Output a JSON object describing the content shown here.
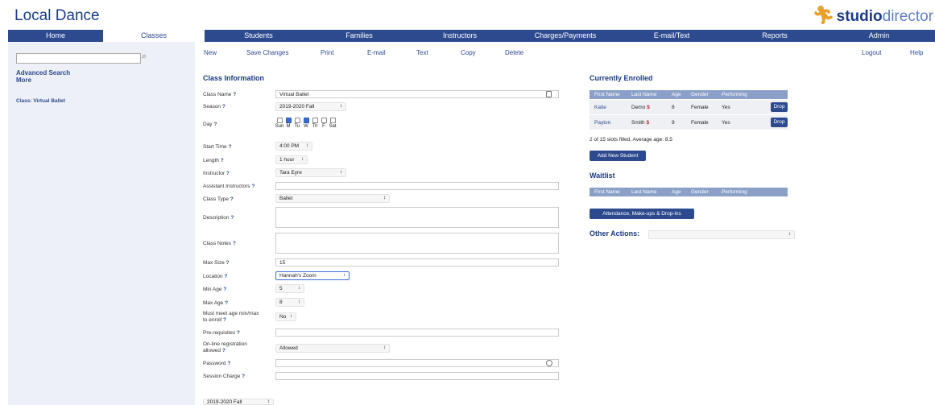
{
  "app": {
    "title": "Local Dance",
    "logo_bold": "studio",
    "logo_light": "director"
  },
  "nav": {
    "tabs": [
      "Home",
      "Classes",
      "Students",
      "Families",
      "Instructors",
      "Charges/Payments",
      "E-mail/Text",
      "Reports",
      "Admin"
    ],
    "active": "Classes"
  },
  "sidebar": {
    "search_value": "",
    "advanced_search": "Advanced Search",
    "more": "More",
    "class_link": "Class: Virtual Ballet"
  },
  "toolbar": {
    "new": "New",
    "save": "Save Changes",
    "print": "Print",
    "email": "E-mail",
    "text": "Text",
    "copy": "Copy",
    "delete": "Delete",
    "logout": "Logout",
    "help": "Help"
  },
  "form": {
    "title": "Class Information",
    "help_mark": "?",
    "class_name": {
      "label": "Class Name",
      "value": "Virtual Ballet"
    },
    "season": {
      "label": "Season",
      "value": "2019-2020 Fall"
    },
    "day": {
      "label": "Day",
      "days": [
        "Sun",
        "M",
        "Tu",
        "W",
        "Th",
        "F",
        "Sat"
      ],
      "checked": [
        false,
        true,
        false,
        true,
        false,
        false,
        false
      ]
    },
    "start_time": {
      "label": "Start Time",
      "value": "4:00 PM"
    },
    "length": {
      "label": "Length",
      "value": "1 hour"
    },
    "instructor": {
      "label": "Instructor",
      "value": "Tara Eyre"
    },
    "assistant": {
      "label": "Assistant Instructors",
      "value": ""
    },
    "class_type": {
      "label": "Class Type",
      "value": "Ballet"
    },
    "description": {
      "label": "Description",
      "value": ""
    },
    "class_notes": {
      "label": "Class Notes",
      "value": ""
    },
    "max_size": {
      "label": "Max Size",
      "value": "15"
    },
    "location": {
      "label": "Location",
      "value": "Hannah's Zoom"
    },
    "min_age": {
      "label": "Min Age",
      "value": "5"
    },
    "max_age": {
      "label": "Max Age",
      "value": "8"
    },
    "must_meet": {
      "label_1": "Must meet age min/max",
      "label_2": "to enroll",
      "value": "No"
    },
    "prereq": {
      "label": "Pre-requisites",
      "value": ""
    },
    "online_reg": {
      "label_1": "On-line registration",
      "label_2": "allowed",
      "value": "Allowed"
    },
    "password": {
      "label": "Password",
      "value": ""
    },
    "session_charge": {
      "label": "Session Charge",
      "value": ""
    },
    "bottom_season": "2019-2020 Fall"
  },
  "enrolled": {
    "title": "Currently Enrolled",
    "headers": [
      "First Name",
      "Last Name",
      "Age",
      "Gender",
      "Performing"
    ],
    "rows": [
      {
        "first": "Katie",
        "last": "Demo",
        "flag": "$",
        "age": "8",
        "gender": "Female",
        "performing": "Yes"
      },
      {
        "first": "Payton",
        "last": "Smith",
        "flag": "$",
        "age": "9",
        "gender": "Female",
        "performing": "Yes"
      }
    ],
    "drop_label": "Drop",
    "summary": "2 of 15 slots filled,  Average age: 8.5",
    "add_button": "Add New Student"
  },
  "waitlist": {
    "title": "Waitlist",
    "headers": [
      "First Name",
      "Last Name",
      "Age",
      "Gender",
      "Performing"
    ]
  },
  "attendance_button": "Attendance, Make-ups & Drop-ins",
  "other_actions": {
    "label": "Other Actions:",
    "value": ""
  },
  "colors": {
    "nav": "#2e4a8f",
    "brand": "#1a3b86",
    "logo_accent": "#e8a02a",
    "table_head": "#8aa0c8"
  }
}
